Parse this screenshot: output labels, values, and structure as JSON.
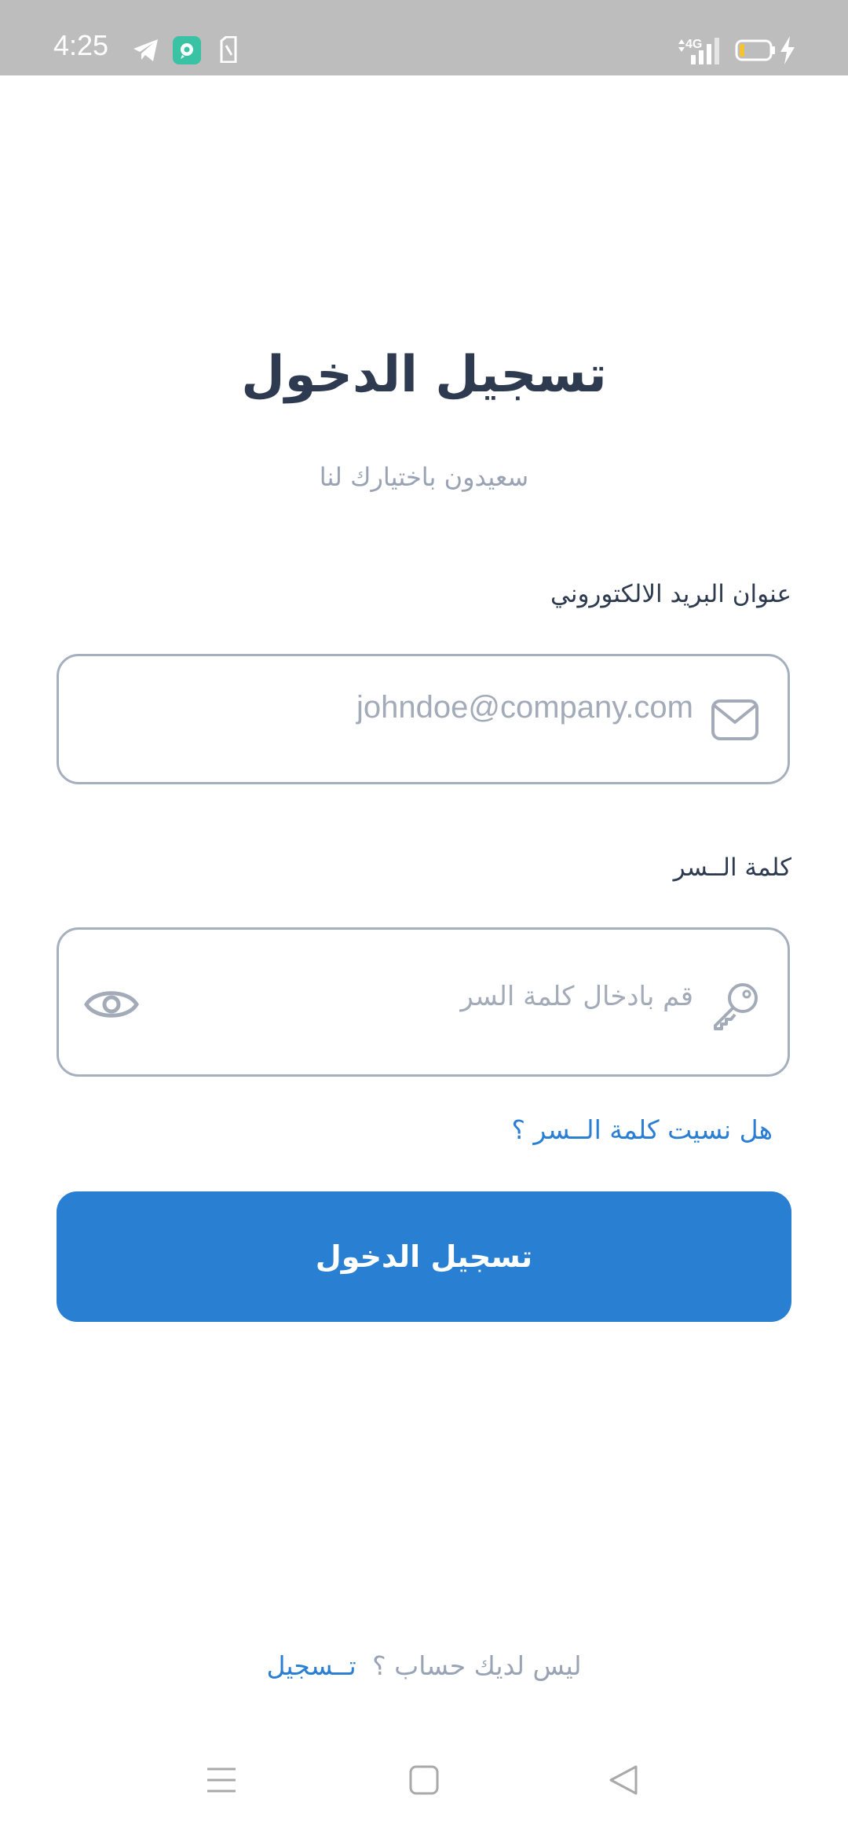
{
  "status_bar": {
    "time": "4:25",
    "network": "4G",
    "icons": [
      "telegram-icon",
      "app-notification-icon",
      "sim-icon",
      "signal-icon",
      "battery-icon",
      "charging-icon"
    ],
    "battery_level": 0.15,
    "battery_color": "#f4c430"
  },
  "login": {
    "title": "تسجيل الدخول",
    "subtitle": "سعيدون باختيارك لنا",
    "email_label": "عنوان البريد الالكتوروني",
    "email_placeholder": "johndoe@company.com",
    "email_value": "",
    "password_label": "كلمة الــسر",
    "password_placeholder": "قم بادخال كلمة السر",
    "password_value": "",
    "forgot_password": "هل نسيت كلمة الــسر ؟",
    "submit_label": "تسجيل الدخول",
    "no_account_text": "ليس لديك حساب ؟",
    "signup_link": "تــسجيل"
  },
  "colors": {
    "accent": "#2980d3",
    "title": "#2e3a4f",
    "muted": "#9aa3b3",
    "border": "#a6afbe"
  },
  "nav_bar": {
    "buttons": [
      "menu-icon",
      "home-icon",
      "back-icon"
    ]
  }
}
